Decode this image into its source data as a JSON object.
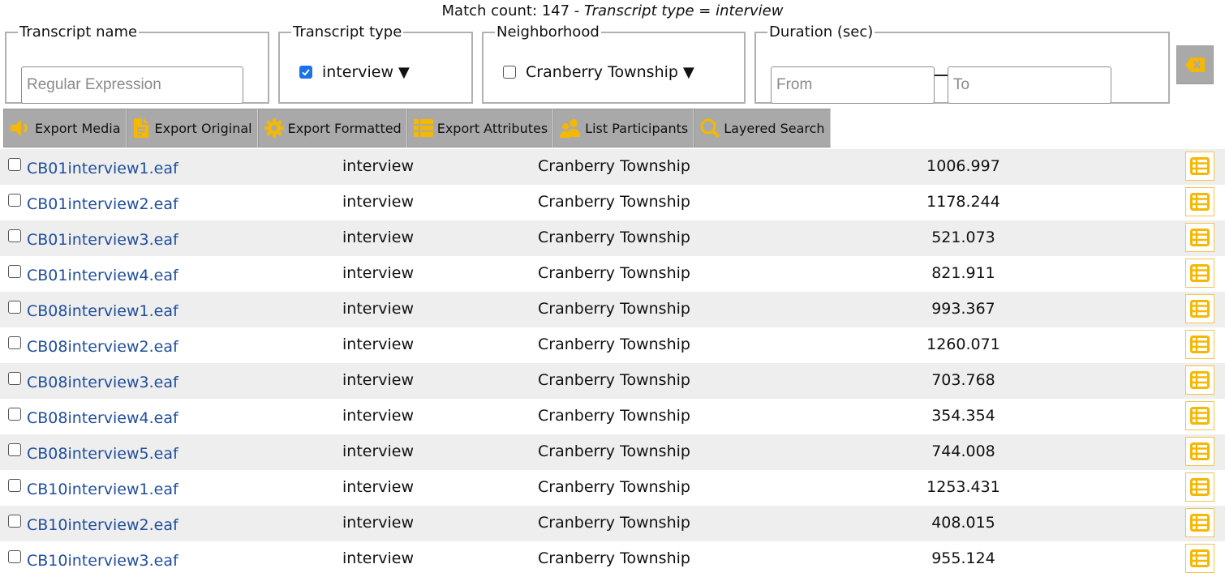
{
  "header": {
    "match_prefix": "Match count: 147 - ",
    "match_filter": "Transcript type = interview"
  },
  "filters": {
    "transcript_name": {
      "legend": "Transcript name",
      "placeholder": "Regular Expression"
    },
    "transcript_type": {
      "legend": "Transcript type",
      "option": "interview",
      "checked": true
    },
    "neighborhood": {
      "legend": "Neighborhood",
      "option": "Cranberry Township",
      "checked": false
    },
    "duration": {
      "legend": "Duration (sec)",
      "from_placeholder": "From",
      "to_placeholder": "To"
    },
    "caret": "▼"
  },
  "toolbar": {
    "export_media": "Export Media",
    "export_original": "Export Original",
    "export_formatted": "Export Formatted",
    "export_attributes": "Export Attributes",
    "list_participants": "List Participants",
    "layered_search": "Layered Search"
  },
  "colors": {
    "accent": "#f5b800",
    "link": "#1f4e9e",
    "button_gray": "#a9a9a9",
    "row_shade": "#eeeeee"
  },
  "rows": [
    {
      "name": "CB01interview1.eaf",
      "type": "interview",
      "neighborhood": "Cranberry Township",
      "duration": "1006.997"
    },
    {
      "name": "CB01interview2.eaf",
      "type": "interview",
      "neighborhood": "Cranberry Township",
      "duration": "1178.244"
    },
    {
      "name": "CB01interview3.eaf",
      "type": "interview",
      "neighborhood": "Cranberry Township",
      "duration": "521.073"
    },
    {
      "name": "CB01interview4.eaf",
      "type": "interview",
      "neighborhood": "Cranberry Township",
      "duration": "821.911"
    },
    {
      "name": "CB08interview1.eaf",
      "type": "interview",
      "neighborhood": "Cranberry Township",
      "duration": "993.367"
    },
    {
      "name": "CB08interview2.eaf",
      "type": "interview",
      "neighborhood": "Cranberry Township",
      "duration": "1260.071"
    },
    {
      "name": "CB08interview3.eaf",
      "type": "interview",
      "neighborhood": "Cranberry Township",
      "duration": "703.768"
    },
    {
      "name": "CB08interview4.eaf",
      "type": "interview",
      "neighborhood": "Cranberry Township",
      "duration": "354.354"
    },
    {
      "name": "CB08interview5.eaf",
      "type": "interview",
      "neighborhood": "Cranberry Township",
      "duration": "744.008"
    },
    {
      "name": "CB10interview1.eaf",
      "type": "interview",
      "neighborhood": "Cranberry Township",
      "duration": "1253.431"
    },
    {
      "name": "CB10interview2.eaf",
      "type": "interview",
      "neighborhood": "Cranberry Township",
      "duration": "408.015"
    },
    {
      "name": "CB10interview3.eaf",
      "type": "interview",
      "neighborhood": "Cranberry Township",
      "duration": "955.124"
    }
  ]
}
